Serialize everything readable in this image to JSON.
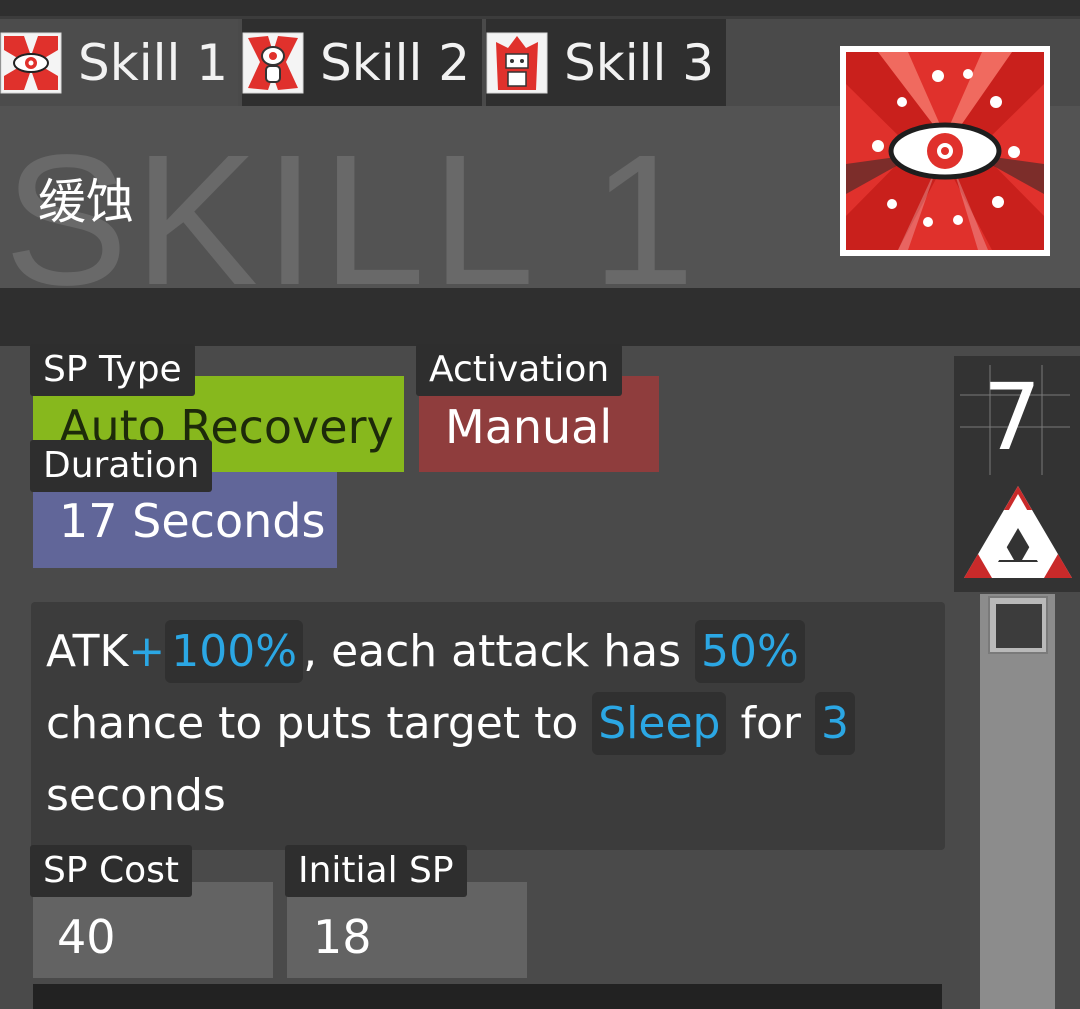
{
  "tabs": [
    {
      "label": "Skill 1",
      "active": true,
      "icon": "eye-skill-icon"
    },
    {
      "label": "Skill 2",
      "active": false,
      "icon": "totem-skill-icon"
    },
    {
      "label": "Skill 3",
      "active": false,
      "icon": "shrine-skill-icon"
    }
  ],
  "skill": {
    "watermark": "SKILL 1",
    "name": "缓蚀",
    "icon": "eye-skill-icon"
  },
  "tags": {
    "sp_type_label": "SP Type",
    "sp_type_value": "Auto Recovery",
    "activation_label": "Activation",
    "activation_value": "Manual",
    "duration_label": "Duration",
    "duration_value": "17 Seconds"
  },
  "description": {
    "p1": "ATK",
    "plus": "+",
    "atk_value": "100%",
    "p2": ", each attack has ",
    "chance_value": "50%",
    "p3": " chance to puts target to ",
    "status_value": "Sleep",
    "p4": " for ",
    "seconds_value": "3",
    "p5": " seconds"
  },
  "sp": {
    "cost_label": "SP Cost",
    "cost_value": "40",
    "initial_label": "Initial SP",
    "initial_value": "18"
  },
  "level": {
    "value": "7",
    "rank_icon": "mastery-triangle-icon"
  },
  "colors": {
    "highlight": "#2ba7e4",
    "sp_type_bg": "#87b81d",
    "activation_bg": "#8f3d3d",
    "duration_bg": "#616699",
    "icon_red": "#e0312c"
  }
}
